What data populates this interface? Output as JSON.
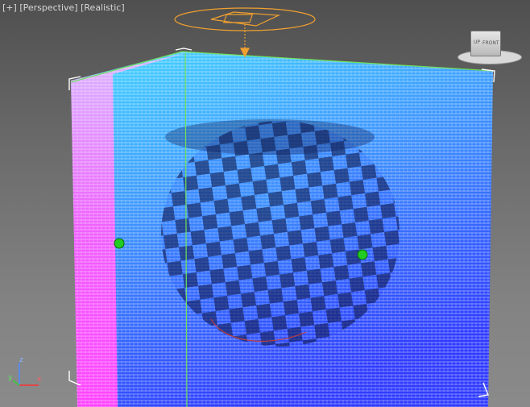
{
  "viewport": {
    "labels": [
      "[+]",
      "[Perspective]",
      "[Realistic]"
    ]
  },
  "viewcube": {
    "top_label": "UP",
    "front_label": "FRONT"
  },
  "axis_tripod": {
    "z_label": "z",
    "x_label": "x",
    "y_label": "y"
  },
  "colors": {
    "background_top": "#4f4f4f",
    "background_bottom": "#8a8a8a",
    "selection_bracket": "#ffffff",
    "bounding_box_edges": "#6ee05a",
    "light_gizmo": "#f0a030",
    "control_points": "#22cc22",
    "volume_cyan": "#39c8ff",
    "volume_blue": "#2a3cff",
    "volume_magenta": "#ff40ff"
  }
}
